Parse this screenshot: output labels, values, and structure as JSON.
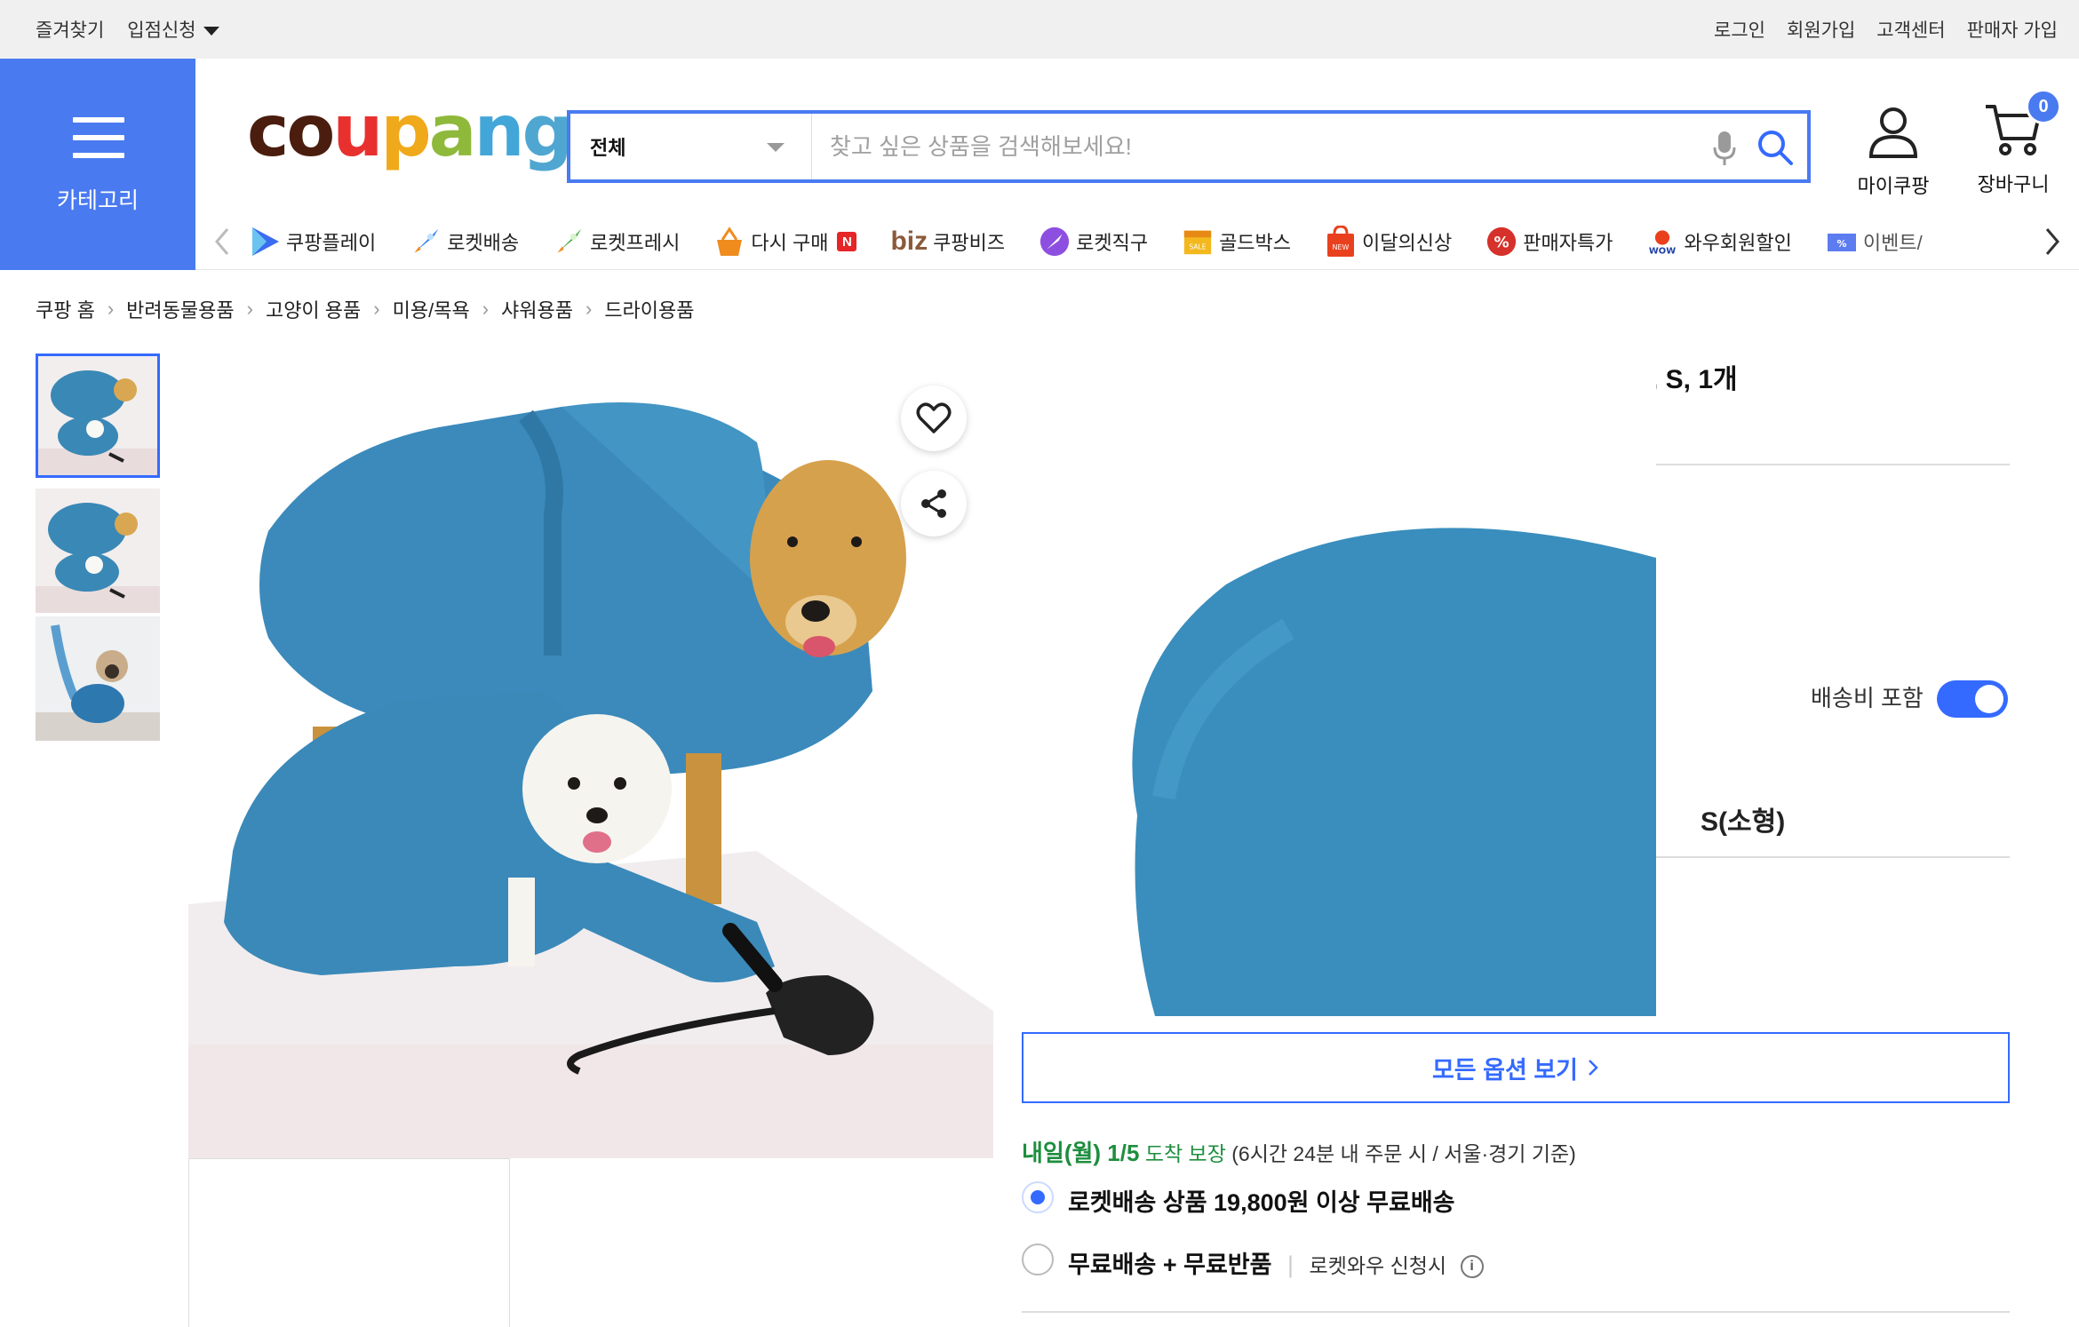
{
  "topbar": {
    "left": [
      "즐겨찾기",
      "입점신청"
    ],
    "right": [
      "로그인",
      "회원가입",
      "고객센터",
      "판매자 가입"
    ]
  },
  "category": {
    "label": "카테고리"
  },
  "logo": {
    "text": "coupang"
  },
  "search": {
    "scope": "전체",
    "placeholder": "찾고 싶은 상품을 검색해보세요!"
  },
  "header": {
    "mycoupang": "마이쿠팡",
    "cart": "장바구니",
    "cart_count": "0"
  },
  "subnav": {
    "items": [
      {
        "label": "쿠팡플레이",
        "icon": "play-icon"
      },
      {
        "label": "로켓배송",
        "icon": "rocket-icon"
      },
      {
        "label": "로켓프레시",
        "icon": "rocket-fresh-icon"
      },
      {
        "label": "다시 구매",
        "icon": "basket-icon",
        "badge": "N"
      },
      {
        "label": "쿠팡비즈",
        "icon": "biz-icon",
        "prefix": "biz"
      },
      {
        "label": "로켓직구",
        "icon": "rocket-global-icon"
      },
      {
        "label": "골드박스",
        "icon": "gold-box-icon"
      },
      {
        "label": "이달의신상",
        "icon": "new-bag-icon"
      },
      {
        "label": "판매자특가",
        "icon": "percent-icon"
      },
      {
        "label": "와우회원할인",
        "icon": "wow-icon"
      },
      {
        "label": "이벤트/",
        "icon": "event-ticket-icon"
      }
    ]
  },
  "breadcrumb": [
    "쿠팡 홈",
    "반려동물용품",
    "고양이 용품",
    "미용/목욕",
    "샤워용품",
    "드라이용품"
  ],
  "product": {
    "title_fragment": ", S, 1개",
    "ship_fee_label": "배송비 포함",
    "option_name": "S(소형)",
    "all_options": "모든 옵션 보기",
    "delivery": {
      "date": "내일(월) 1/5",
      "guarantee": "도착 보장",
      "note": "(6시간 24분 내 주문 시 / 서울·경기 기준)"
    },
    "shipping_options": [
      {
        "label": "로켓배송 상품 19,800원 이상 무료배송",
        "selected": true
      },
      {
        "label": "무료배송 + 무료반품",
        "sub": "로켓와우 신청시",
        "selected": false
      }
    ]
  },
  "colors": {
    "accent": "#346aff",
    "category_bg": "#4a7af0",
    "green": "#1e8e3e"
  }
}
